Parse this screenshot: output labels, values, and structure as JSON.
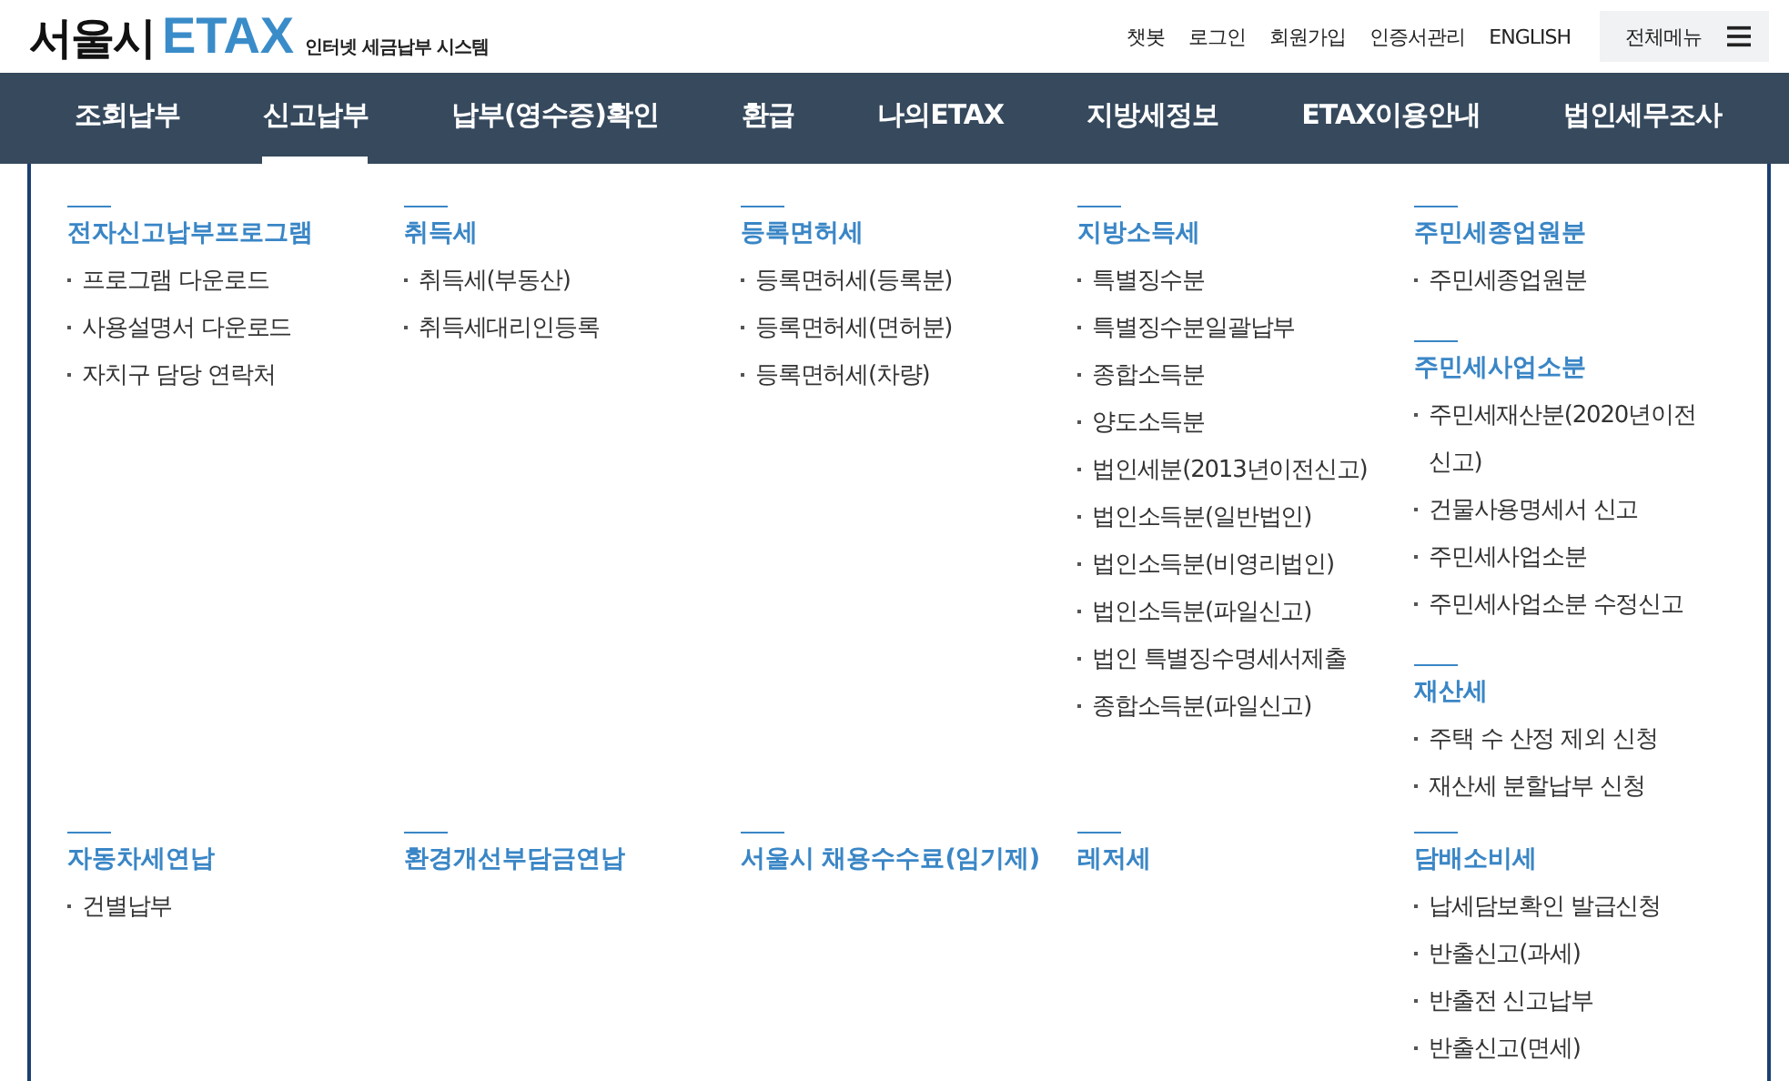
{
  "header": {
    "logo_main": "서울시",
    "logo_accent": "ETAX",
    "tagline": "인터넷 세금납부 시스템",
    "links": [
      "챗봇",
      "로그인",
      "회원가입",
      "인증서관리",
      "ENGLISH"
    ],
    "menu_button": "전체메뉴"
  },
  "nav": [
    {
      "label": "조회납부",
      "selected": false
    },
    {
      "label": "신고납부",
      "selected": true
    },
    {
      "label": "납부(영수증)확인",
      "selected": false
    },
    {
      "label": "환급",
      "selected": false
    },
    {
      "label": "나의ETAX",
      "selected": false
    },
    {
      "label": "지방세정보",
      "selected": false
    },
    {
      "label": "ETAX이용안내",
      "selected": false
    },
    {
      "label": "법인세무조사",
      "selected": false
    }
  ],
  "menu_rows": [
    {
      "columns": [
        [
          {
            "title": "전자신고납부프로그램",
            "items": [
              "프로그램 다운로드",
              "사용설명서 다운로드",
              "자치구 담당 연락처"
            ]
          }
        ],
        [
          {
            "title": "취득세",
            "items": [
              "취득세(부동산)",
              "취득세대리인등록"
            ]
          }
        ],
        [
          {
            "title": "등록면허세",
            "items": [
              "등록면허세(등록분)",
              "등록면허세(면허분)",
              "등록면허세(차량)"
            ]
          }
        ],
        [
          {
            "title": "지방소득세",
            "items": [
              "특별징수분",
              "특별징수분일괄납부",
              "종합소득분",
              "양도소득분",
              "법인세분(2013년이전신고)",
              "법인소득분(일반법인)",
              "법인소득분(비영리법인)",
              "법인소득분(파일신고)",
              "법인 특별징수명세서제출",
              "종합소득분(파일신고)"
            ]
          }
        ],
        [
          {
            "title": "주민세종업원분",
            "items": [
              "주민세종업원분"
            ]
          },
          {
            "title": "주민세사업소분",
            "items": [
              "주민세재산분(2020년이전 신고)",
              "건물사용명세서 신고",
              "주민세사업소분",
              "주민세사업소분 수정신고"
            ]
          },
          {
            "title": "재산세",
            "items": [
              "주택 수 산정 제외 신청",
              "재산세 분할납부 신청"
            ]
          }
        ]
      ]
    },
    {
      "columns": [
        [
          {
            "title": "자동차세연납",
            "items": [
              "건별납부"
            ]
          }
        ],
        [
          {
            "title": "환경개선부담금연납"
          }
        ],
        [
          {
            "title": "서울시 채용수수료(임기제)"
          }
        ],
        [
          {
            "title": "레저세"
          }
        ],
        [
          {
            "title": "담배소비세",
            "items": [
              "납세담보확인 발급신청",
              "반출신고(과세)",
              "반출전 신고납부",
              "반출신고(면세)"
            ]
          }
        ]
      ]
    }
  ]
}
